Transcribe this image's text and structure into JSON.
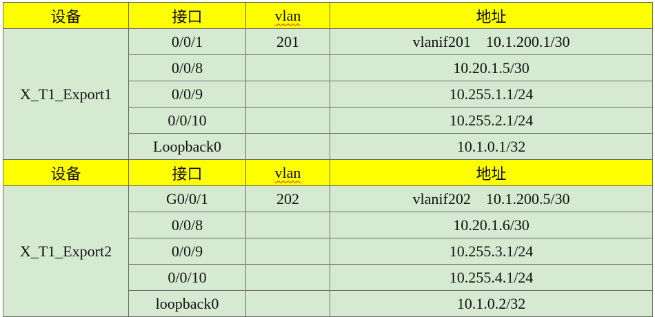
{
  "header": {
    "device": "设备",
    "interface": "接口",
    "vlan": "vlan",
    "address": "地址"
  },
  "devices": [
    {
      "name": "X_T1_Export1",
      "rows": [
        {
          "interface": "0/0/1",
          "vlan": "201",
          "address": "vlanif201    10.1.200.1/30"
        },
        {
          "interface": "0/0/8",
          "vlan": "",
          "address": "10.20.1.5/30"
        },
        {
          "interface": "0/0/9",
          "vlan": "",
          "address": "10.255.1.1/24"
        },
        {
          "interface": "0/0/10",
          "vlan": "",
          "address": "10.255.2.1/24"
        },
        {
          "interface": "Loopback0",
          "vlan": "",
          "address": "10.1.0.1/32"
        }
      ]
    },
    {
      "name": "X_T1_Export2",
      "rows": [
        {
          "interface": "G0/0/1",
          "vlan": "202",
          "address": "vlanif202    10.1.200.5/30"
        },
        {
          "interface": "0/0/8",
          "vlan": "",
          "address": "10.20.1.6/30"
        },
        {
          "interface": "0/0/9",
          "vlan": "",
          "address": "10.255.3.1/24"
        },
        {
          "interface": "0/0/10",
          "vlan": "",
          "address": "10.255.4.1/24"
        },
        {
          "interface": "loopback0",
          "vlan": "",
          "address": "10.1.0.2/32"
        }
      ]
    }
  ]
}
